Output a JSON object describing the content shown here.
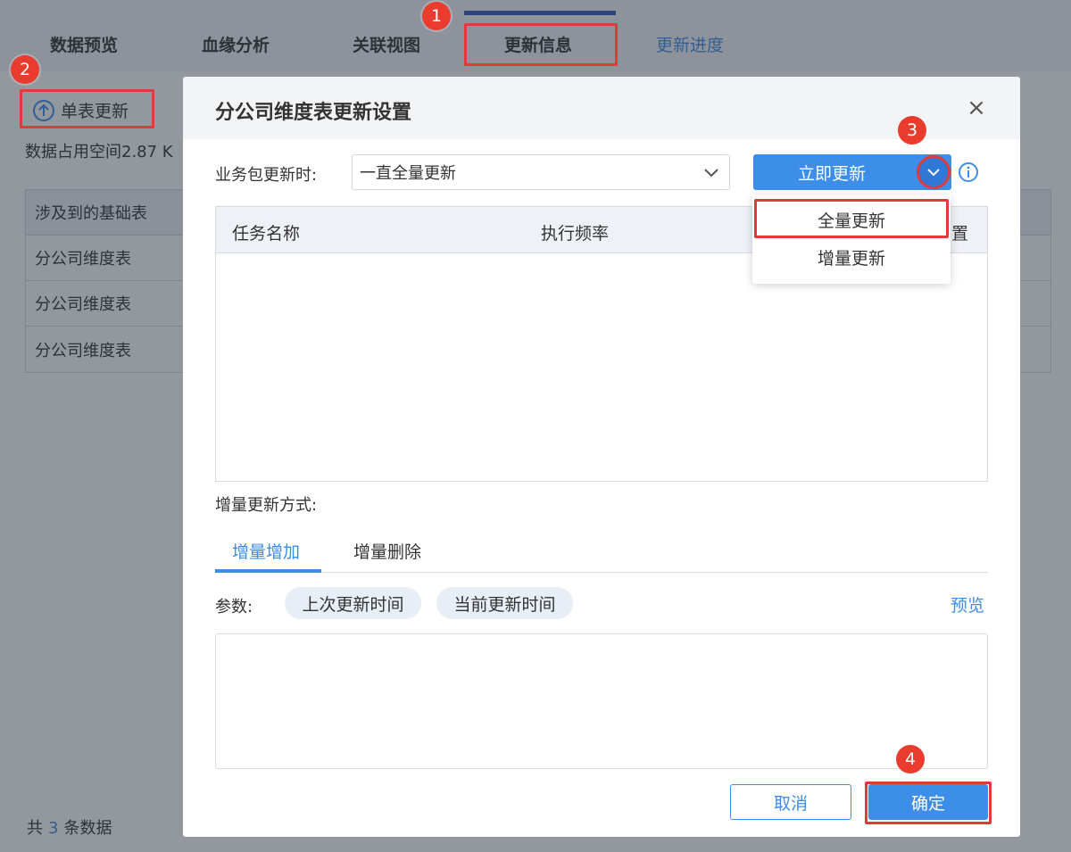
{
  "tabs": [
    "数据预览",
    "血缘分析",
    "关联视图",
    "更新信息",
    "更新进度"
  ],
  "toolbar": {
    "single_update": "单表更新",
    "space_text": "数据占用空间2.87 K"
  },
  "base_table": {
    "header": "涉及到的基础表",
    "rows": [
      "分公司维度表",
      "分公司维度表",
      "分公司维度表"
    ]
  },
  "footer": {
    "prefix": "共",
    "count": "3",
    "suffix": "条数据"
  },
  "dialog": {
    "title": "分公司维度表更新设置",
    "close": "×",
    "update_label": "业务包更新时:",
    "update_select": "一直全量更新",
    "update_now": "立即更新",
    "dropdown": [
      "全量更新",
      "增量更新"
    ],
    "task_table": {
      "col_name": "任务名称",
      "col_freq": "执行频率",
      "col_set": "置"
    },
    "inc_label": "增量更新方式:",
    "inc_tabs": [
      "增量增加",
      "增量删除"
    ],
    "params_label": "参数:",
    "params": [
      "上次更新时间",
      "当前更新时间"
    ],
    "preview": "预览",
    "cancel": "取消",
    "ok": "确定"
  },
  "annotations": [
    "1",
    "2",
    "3",
    "4"
  ],
  "colors": {
    "accent": "#3d8ee8",
    "annotation": "#e03a3a",
    "badge": "#ea3b2f",
    "tab_indicator": "#2f5ab8"
  }
}
